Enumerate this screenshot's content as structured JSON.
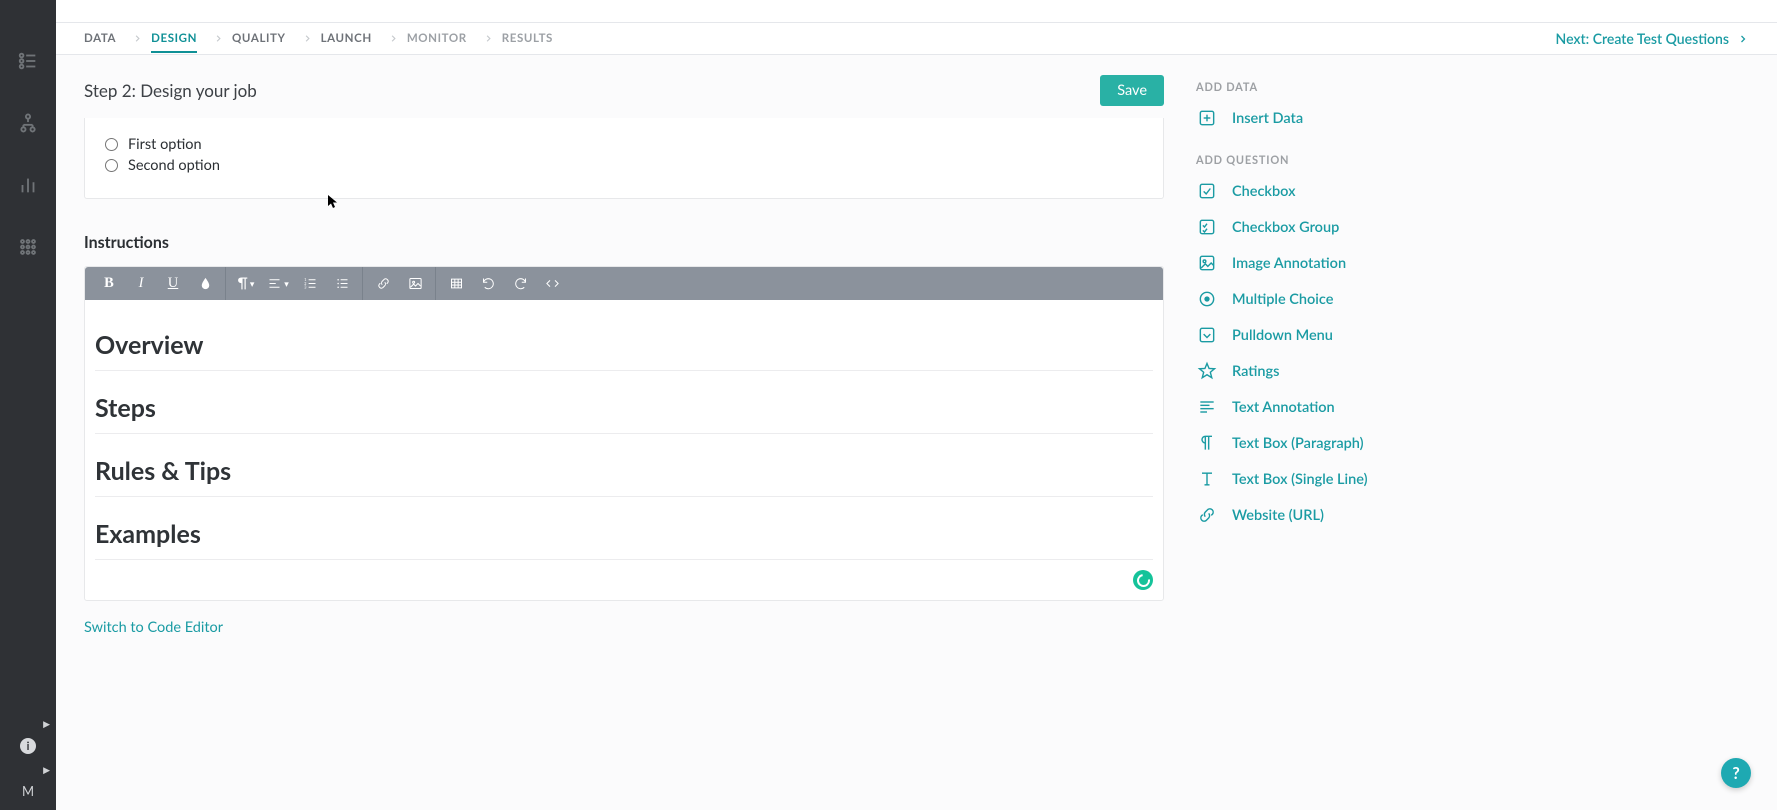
{
  "crumbs": {
    "data": "DATA",
    "design": "DESIGN",
    "quality": "QUALITY",
    "launch": "LAUNCH",
    "monitor": "MONITOR",
    "results": "RESULTS"
  },
  "next_link": "Next: Create Test Questions",
  "step_title": "Step 2: Design your job",
  "save_label": "Save",
  "options": {
    "first": "First option",
    "second": "Second option"
  },
  "instructions_label": "Instructions",
  "editor_headings": {
    "overview": "Overview",
    "steps": "Steps",
    "rules": "Rules & Tips",
    "examples": "Examples"
  },
  "code_editor_link": "Switch to Code Editor",
  "right": {
    "add_data_header": "ADD DATA",
    "insert_data": "Insert Data",
    "add_question_header": "ADD QUESTION",
    "items": {
      "checkbox": "Checkbox",
      "checkbox_group": "Checkbox Group",
      "image_annotation": "Image Annotation",
      "multiple_choice": "Multiple Choice",
      "pulldown": "Pulldown Menu",
      "ratings": "Ratings",
      "text_annotation": "Text Annotation",
      "textbox_para": "Text Box (Paragraph)",
      "textbox_single": "Text Box (Single Line)",
      "website": "Website (URL)"
    }
  },
  "rail_avatar": "M",
  "help_fab": "?"
}
